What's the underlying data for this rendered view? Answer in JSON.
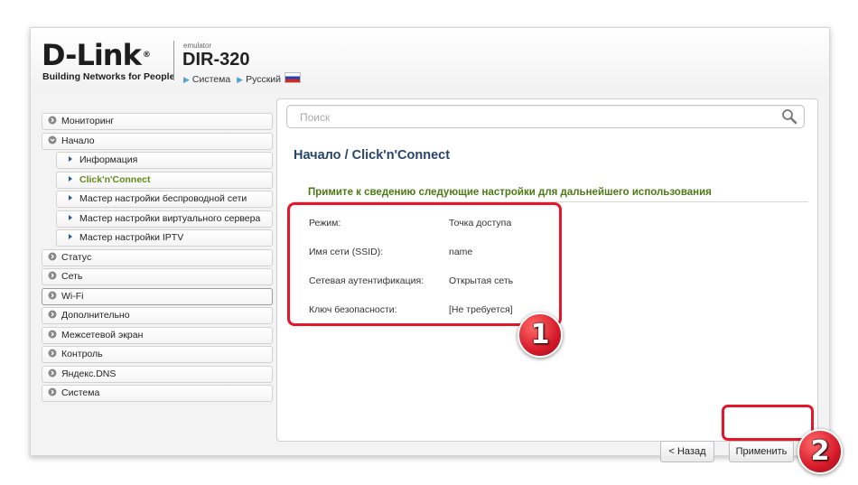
{
  "header": {
    "logo": "D-Link",
    "logo_reg": "®",
    "tagline": "Building Networks for People",
    "emulator": "emulator",
    "model": "DIR-320",
    "link_system": "Система",
    "link_language": "Русский"
  },
  "sidebar": {
    "items": [
      {
        "label": "Мониторинг"
      },
      {
        "label": "Начало"
      },
      {
        "label": "Информация"
      },
      {
        "label": "Click'n'Connect"
      },
      {
        "label": "Мастер настройки беспроводной сети"
      },
      {
        "label": "Мастер настройки виртуального сервера"
      },
      {
        "label": "Мастер настройки IPTV"
      },
      {
        "label": "Статус"
      },
      {
        "label": "Сеть"
      },
      {
        "label": "Wi-Fi"
      },
      {
        "label": "Дополнительно"
      },
      {
        "label": "Межсетевой экран"
      },
      {
        "label": "Контроль"
      },
      {
        "label": "Яндекс.DNS"
      },
      {
        "label": "Система"
      }
    ]
  },
  "search": {
    "placeholder": "Поиск",
    "value": ""
  },
  "main": {
    "breadcrumb": "Начало /  Click'n'Connect",
    "section_title": "Примите к сведению следующие настройки для дальнейшего использования",
    "settings": [
      {
        "key": "Режим:",
        "value": "Точка доступа"
      },
      {
        "key": "Имя сети (SSID):",
        "value": "name"
      },
      {
        "key": "Сетевая аутентификация:",
        "value": "Открытая сеть"
      },
      {
        "key": "Ключ безопасности:",
        "value": "[Не требуется]"
      }
    ],
    "back_button": "< Назад",
    "apply_button": "Применить"
  },
  "annotations": {
    "badge1": "1",
    "badge2": "2"
  },
  "colors": {
    "accent_green": "#5f8a1a",
    "title_blue": "#27456b",
    "highlight_red": "#e5152c"
  }
}
